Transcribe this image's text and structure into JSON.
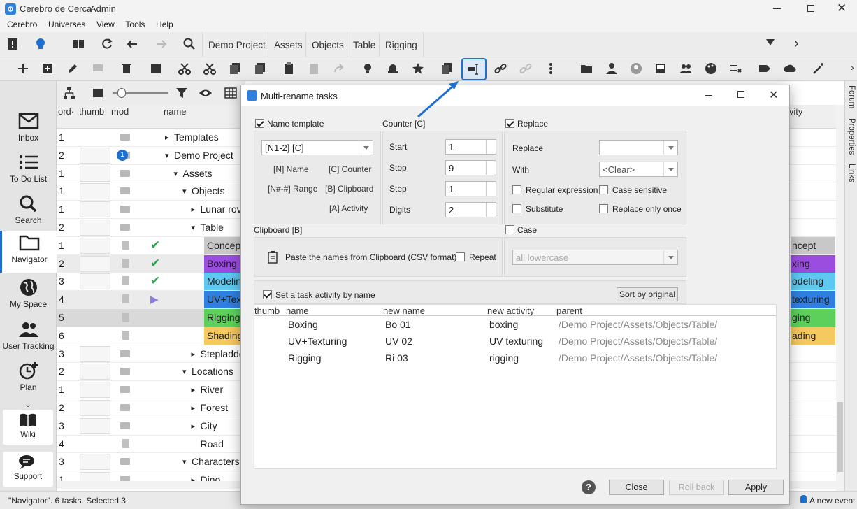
{
  "window": {
    "app_name": "Cerebro de Cerca",
    "user": "Admin"
  },
  "menu": [
    "Cerebro",
    "Universes",
    "View",
    "Tools",
    "Help"
  ],
  "nav_tabs": [
    "Demo Project",
    "Assets",
    "Objects",
    "Table",
    "Rigging"
  ],
  "tree_columns": {
    "order": "ord·",
    "thumb": "thumb",
    "mod": "mod",
    "name": "name",
    "activity": "ivity"
  },
  "left_nav": [
    {
      "label": "Inbox",
      "icon": "mail-icon"
    },
    {
      "label": "To Do List",
      "icon": "list-icon"
    },
    {
      "label": "Search",
      "icon": "search-icon"
    },
    {
      "label": "Navigator",
      "icon": "folder-icon"
    },
    {
      "label": "My Space",
      "icon": "globe-icon"
    },
    {
      "label": "User Tracking",
      "icon": "users-icon"
    },
    {
      "label": "Plan",
      "icon": "clock-plus-icon"
    }
  ],
  "left_nav_bottom": [
    "Wiki",
    "Support"
  ],
  "right_strip": [
    "Forum",
    "Properties",
    "Links"
  ],
  "tree_rows": [
    {
      "ord": "1",
      "name": "Templates",
      "indent": 0,
      "arrow": "▸"
    },
    {
      "ord": "2",
      "name": "Demo Project",
      "indent": 0,
      "arrow": "▾"
    },
    {
      "ord": "1",
      "name": "Assets",
      "indent": 1,
      "arrow": "▾"
    },
    {
      "ord": "1",
      "name": "Objects",
      "indent": 2,
      "arrow": "▾"
    },
    {
      "ord": "1",
      "name": "Lunar rove",
      "indent": 3,
      "arrow": "▸"
    },
    {
      "ord": "2",
      "name": "Table",
      "indent": 3,
      "arrow": "▾"
    },
    {
      "ord": "1",
      "name": "Concept",
      "tag": true
    },
    {
      "ord": "2",
      "name": "Boxing",
      "tag": true
    },
    {
      "ord": "3",
      "name": "Modeling",
      "tag": true
    },
    {
      "ord": "4",
      "name": "UV+Text",
      "tag": true
    },
    {
      "ord": "5",
      "name": "Rigging",
      "tag": true
    },
    {
      "ord": "6",
      "name": "Shading",
      "tag": true
    },
    {
      "ord": "3",
      "name": "Stepladder",
      "indent": 3,
      "arrow": "▸"
    },
    {
      "ord": "2",
      "name": "Locations",
      "indent": 2,
      "arrow": "▾"
    },
    {
      "ord": "1",
      "name": "River",
      "indent": 3,
      "arrow": "▸"
    },
    {
      "ord": "2",
      "name": "Forest",
      "indent": 3,
      "arrow": "▸"
    },
    {
      "ord": "3",
      "name": "City",
      "indent": 3,
      "arrow": "▸"
    },
    {
      "ord": "4",
      "name": "Road",
      "indent": 3,
      "arrow": ""
    },
    {
      "ord": "3",
      "name": "Characters",
      "indent": 2,
      "arrow": "▾"
    },
    {
      "ord": "1",
      "name": "Dino",
      "indent": 3,
      "arrow": "▸"
    }
  ],
  "right_tags": [
    "ncept",
    "xing",
    "odeling",
    "texturing",
    "ging",
    "ading"
  ],
  "badge_count": "1",
  "status": {
    "left": "\"Navigator\". 6 tasks. Selected 3",
    "right": "A new event"
  },
  "dialog": {
    "title": "Multi-rename tasks",
    "name_template": {
      "label": "Name template",
      "value": "[N1-2] [C]",
      "links": [
        "[N] Name",
        "[C] Counter",
        "[N#-#] Range",
        "[B] Clipboard",
        "[A] Activity"
      ]
    },
    "counter": {
      "label": "Counter [C]",
      "start_label": "Start",
      "start": "1",
      "stop_label": "Stop",
      "stop": "9",
      "step_label": "Step",
      "step": "1",
      "digits_label": "Digits",
      "digits": "2"
    },
    "replace": {
      "label": "Replace",
      "replace_label": "Replace",
      "replace_value": "",
      "with_label": "With",
      "with_value": "<Clear>",
      "regex": "Regular expression",
      "case_sensitive": "Case sensitive",
      "substitute": "Substitute",
      "replace_once": "Replace only once"
    },
    "clipboard": {
      "label": "Clipboard [B]",
      "paste": "Paste the names from Clipboard (CSV format)",
      "repeat": "Repeat"
    },
    "case": {
      "label": "Case",
      "value": "all lowercase"
    },
    "activity": {
      "label": "Set a task activity by name",
      "sort_button": "Sort by original"
    },
    "grid_columns": [
      "thumb",
      "name",
      "new name",
      "new activity",
      "parent"
    ],
    "grid_rows": [
      {
        "name": "Boxing",
        "new_name": "Bo 01",
        "new_activity": "boxing",
        "parent": "/Demo Project/Assets/Objects/Table/"
      },
      {
        "name": "UV+Texturing",
        "new_name": "UV 02",
        "new_activity": "UV texturing",
        "parent": "/Demo Project/Assets/Objects/Table/"
      },
      {
        "name": "Rigging",
        "new_name": "Ri 03",
        "new_activity": "rigging",
        "parent": "/Demo Project/Assets/Objects/Table/"
      }
    ],
    "buttons": {
      "help": "?",
      "close": "Close",
      "rollback": "Roll back",
      "apply": "Apply"
    }
  },
  "colors": {
    "accent": "#1f6fd0",
    "boxing": "#9b4de0",
    "modeling": "#5ec8f0",
    "uv": "#2f7fe0",
    "rigging": "#5cd05a",
    "shading": "#f5c860",
    "concept": "#c8c8c8"
  }
}
